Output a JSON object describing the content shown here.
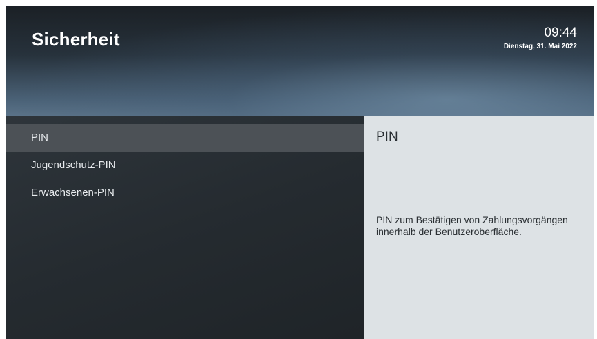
{
  "header": {
    "title": "Sicherheit",
    "time": "09:44",
    "date": "Dienstag, 31. Mai 2022"
  },
  "menu": {
    "items": [
      {
        "label": "PIN",
        "selected": true
      },
      {
        "label": "Jugendschutz-PIN",
        "selected": false
      },
      {
        "label": "Erwachsenen-PIN",
        "selected": false
      }
    ]
  },
  "detail": {
    "title": "PIN",
    "description": "PIN zum Bestätigen von Zahlungsvorgängen innerhalb der Benutzeroberfläche."
  },
  "colors": {
    "selected_item": "#4c5156",
    "detail_panel": "#dde2e5",
    "background": "#22282d"
  }
}
